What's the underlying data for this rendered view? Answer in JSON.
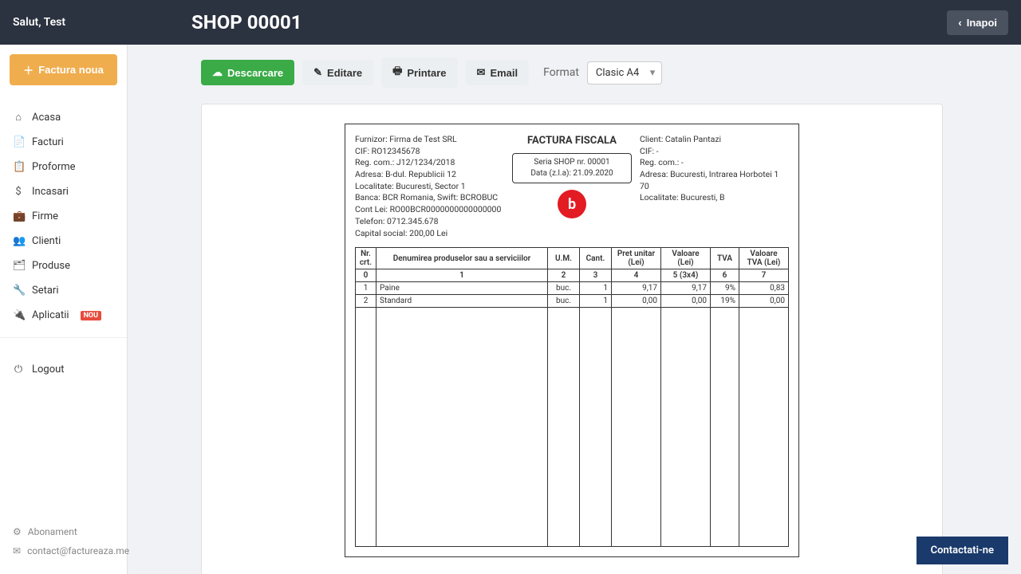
{
  "header": {
    "greeting": "Salut, Test",
    "title": "SHOP 00001",
    "back_label": "Inapoi"
  },
  "sidebar": {
    "new_invoice_label": "Factura noua",
    "items": [
      {
        "label": "Acasa",
        "icon": "⌂"
      },
      {
        "label": "Facturi",
        "icon": "📄"
      },
      {
        "label": "Proforme",
        "icon": "📋"
      },
      {
        "label": "Incasari",
        "icon": "$"
      },
      {
        "label": "Firme",
        "icon": "💼"
      },
      {
        "label": "Clienti",
        "icon": "👥"
      },
      {
        "label": "Produse",
        "icon": "🗂"
      },
      {
        "label": "Setari",
        "icon": "🔧"
      },
      {
        "label": "Aplicatii",
        "icon": "🔌",
        "badge": "NOU"
      }
    ],
    "logout_label": "Logout",
    "footer": {
      "subscription": "Abonament",
      "email": "contact@factureaza.me"
    }
  },
  "toolbar": {
    "download_label": "Descarcare",
    "edit_label": "Editare",
    "print_label": "Printare",
    "email_label": "Email",
    "format_label": "Format",
    "format_value": "Clasic A4"
  },
  "invoice": {
    "heading": "FACTURA FISCALA",
    "series_line": "Seria SHOP nr. 00001",
    "date_line": "Data (z.l.a): 21.09.2020",
    "supplier": {
      "furnizor": "Furnizor: Firma de Test SRL",
      "cif": "CIF: RO12345678",
      "reg": "Reg. com.: J12/1234/2018",
      "adresa": "Adresa: B-dul. Republicii 12",
      "loc": "Localitate: Bucuresti, Sector 1",
      "banca": "Banca: BCR Romania, Swift: BCROBUC",
      "cont": "Cont Lei: RO00BCR0000000000000000",
      "tel": "Telefon: 0712.345.678",
      "capital": "Capital social: 200,00 Lei"
    },
    "client": {
      "client": "Client: Catalin Pantazi",
      "cif": "CIF: -",
      "reg": "Reg. com.: -",
      "adresa": "Adresa: Bucuresti, Intrarea Horbotei 1 70",
      "loc": "Localitate: Bucuresti, B"
    },
    "columns": {
      "nr": "Nr. crt.",
      "desc": "Denumirea produselor sau a serviciilor",
      "um": "U.M.",
      "cant": "Cant.",
      "pret": "Pret unitar (Lei)",
      "valoare": "Valoare (Lei)",
      "tva_pct": "TVA",
      "tva_val": "Valoare TVA (Lei)"
    },
    "col_index": {
      "c0": "0",
      "c1": "1",
      "c2": "2",
      "c3": "3",
      "c4": "4",
      "c5": "5 (3x4)",
      "c6": "6",
      "c7": "7"
    },
    "rows": [
      {
        "nr": "1",
        "desc": "Paine",
        "um": "buc.",
        "cant": "1",
        "pret": "9,17",
        "valoare": "9,17",
        "tva_pct": "9%",
        "tva_val": "0,83"
      },
      {
        "nr": "2",
        "desc": "Standard",
        "um": "buc.",
        "cant": "1",
        "pret": "0,00",
        "valoare": "0,00",
        "tva_pct": "19%",
        "tva_val": "0,00"
      }
    ]
  },
  "contact_fab": "Contactati-ne"
}
